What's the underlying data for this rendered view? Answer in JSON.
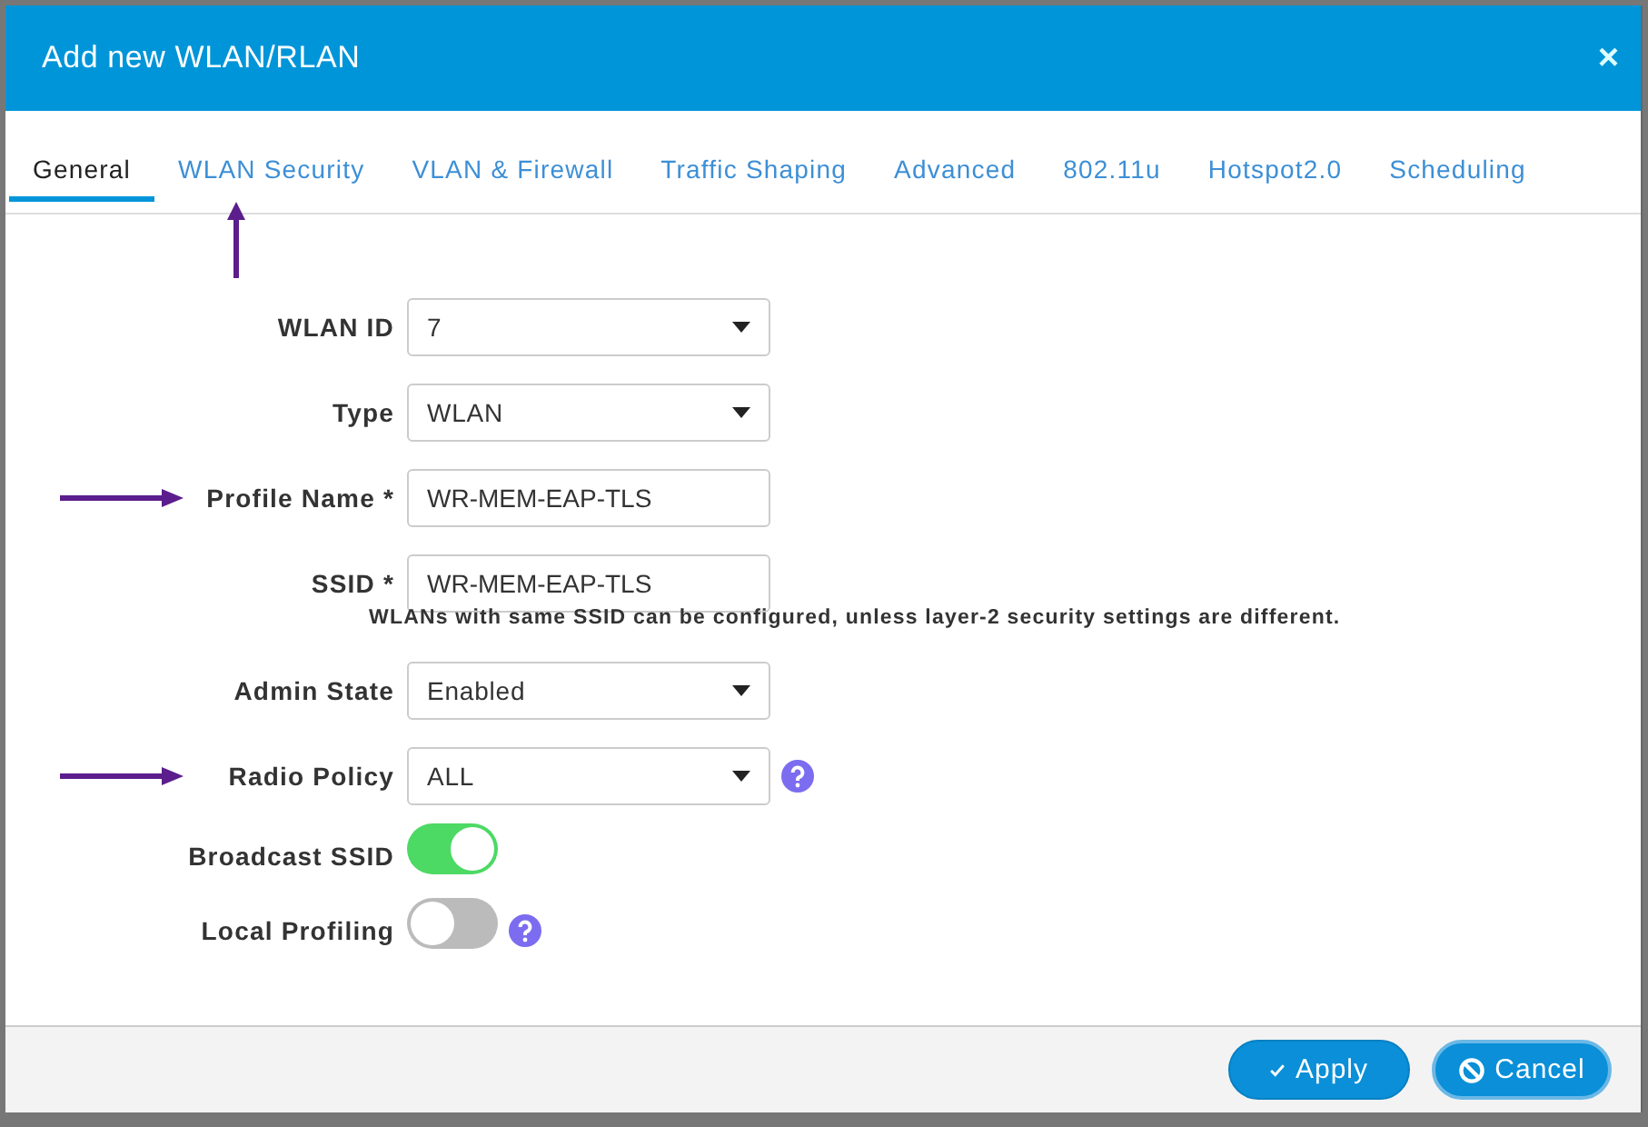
{
  "window": {
    "title": "Add new WLAN/RLAN",
    "close": "×"
  },
  "tabs": [
    {
      "label": "General",
      "selected": true,
      "annotated": false
    },
    {
      "label": "WLAN Security",
      "selected": false,
      "annotated": true
    },
    {
      "label": "VLAN & Firewall",
      "selected": false,
      "annotated": false
    },
    {
      "label": "Traffic Shaping",
      "selected": false,
      "annotated": false
    },
    {
      "label": "Advanced",
      "selected": false,
      "annotated": false
    },
    {
      "label": "802.11u",
      "selected": false,
      "annotated": false
    },
    {
      "label": "Hotspot2.0",
      "selected": false,
      "annotated": false
    },
    {
      "label": "Scheduling",
      "selected": false,
      "annotated": false
    }
  ],
  "fields": [
    {
      "kind": "select",
      "label": "WLAN ID",
      "value": "7",
      "help": false,
      "annotated": false
    },
    {
      "kind": "select",
      "label": "Type",
      "value": "WLAN",
      "help": false,
      "annotated": false
    },
    {
      "kind": "text",
      "label": "Profile Name *",
      "value": "WR-MEM-EAP-TLS",
      "help": false,
      "annotated": true
    },
    {
      "kind": "text",
      "label": "SSID *",
      "value": "WR-MEM-EAP-TLS",
      "help": false,
      "annotated": false,
      "note": "WLANs with same SSID can be configured, unless layer-2 security settings are different."
    },
    {
      "kind": "select",
      "label": "Admin State",
      "value": "Enabled",
      "help": false,
      "annotated": false
    },
    {
      "kind": "select",
      "label": "Radio Policy",
      "value": "ALL",
      "help": true,
      "annotated": true
    },
    {
      "kind": "toggle",
      "label": "Broadcast SSID",
      "on": true,
      "help": false,
      "annotated": false
    },
    {
      "kind": "toggle",
      "label": "Local Profiling",
      "on": false,
      "help": true,
      "annotated": false
    }
  ],
  "buttons": [
    {
      "kind": "apply",
      "label": "Apply"
    },
    {
      "kind": "cancel",
      "label": "Cancel"
    }
  ]
}
